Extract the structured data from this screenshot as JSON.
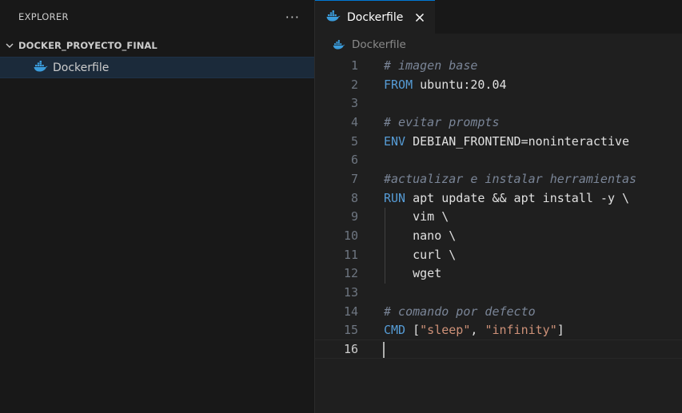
{
  "explorer": {
    "title": "EXPLORER",
    "more": "···",
    "section": "DOCKER_PROYECTO_FINAL",
    "file": "Dockerfile"
  },
  "tab": {
    "label": "Dockerfile"
  },
  "breadcrumb": {
    "label": "Dockerfile"
  },
  "colors": {
    "accent": "#0078d4",
    "docker_blue": "#3b9cdb",
    "keyword": "#569cd6",
    "comment": "#7a8597",
    "string": "#ce9178"
  },
  "code": {
    "current_line": 16,
    "lines": [
      {
        "n": "1",
        "parts": [
          {
            "t": "# imagen base",
            "c": "cm"
          }
        ]
      },
      {
        "n": "2",
        "parts": [
          {
            "t": "FROM",
            "c": "kw"
          },
          {
            "t": " ubuntu:20.04",
            "c": "pl"
          }
        ]
      },
      {
        "n": "3",
        "parts": []
      },
      {
        "n": "4",
        "parts": [
          {
            "t": "# evitar prompts",
            "c": "cm"
          }
        ]
      },
      {
        "n": "5",
        "parts": [
          {
            "t": "ENV",
            "c": "kw"
          },
          {
            "t": " DEBIAN_FRONTEND=noninteractive",
            "c": "pl"
          }
        ]
      },
      {
        "n": "6",
        "parts": []
      },
      {
        "n": "7",
        "parts": [
          {
            "t": "#actualizar e instalar herramientas",
            "c": "cm"
          }
        ]
      },
      {
        "n": "8",
        "parts": [
          {
            "t": "RUN",
            "c": "kw"
          },
          {
            "t": " apt update && apt install -y \\",
            "c": "pl"
          }
        ]
      },
      {
        "n": "9",
        "parts": [
          {
            "t": "    vim \\",
            "c": "pl"
          }
        ]
      },
      {
        "n": "10",
        "parts": [
          {
            "t": "    nano \\",
            "c": "pl"
          }
        ]
      },
      {
        "n": "11",
        "parts": [
          {
            "t": "    curl \\",
            "c": "pl"
          }
        ]
      },
      {
        "n": "12",
        "parts": [
          {
            "t": "    wget",
            "c": "pl"
          }
        ]
      },
      {
        "n": "13",
        "parts": []
      },
      {
        "n": "14",
        "parts": [
          {
            "t": "# comando por defecto",
            "c": "cm"
          }
        ]
      },
      {
        "n": "15",
        "parts": [
          {
            "t": "CMD",
            "c": "kw"
          },
          {
            "t": " [",
            "c": "pl"
          },
          {
            "t": "\"sleep\"",
            "c": "str"
          },
          {
            "t": ", ",
            "c": "pl"
          },
          {
            "t": "\"infinity\"",
            "c": "str"
          },
          {
            "t": "]",
            "c": "pl"
          }
        ]
      },
      {
        "n": "16",
        "parts": []
      }
    ]
  }
}
